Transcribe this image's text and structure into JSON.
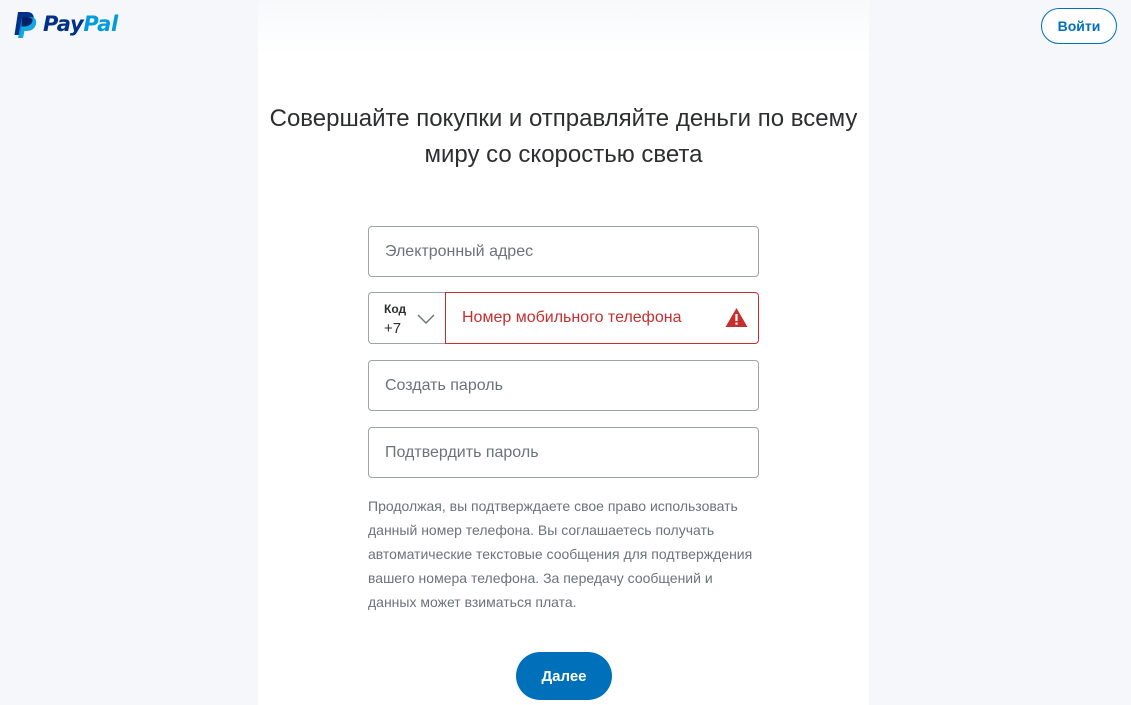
{
  "header": {
    "logo": {
      "text_part1": "Pay",
      "text_part2": "Pal",
      "icon": "paypal-p-icon"
    },
    "login_label": "Войти"
  },
  "form": {
    "headline": "Совершайте покупки и отправляйте деньги по всему миру со скоростью света",
    "email_placeholder": "Электронный адрес",
    "country_code": {
      "label": "Код",
      "value": "+7",
      "icon": "chevron-down-icon"
    },
    "phone": {
      "placeholder": "Номер мобильного телефона",
      "error_icon": "warning-triangle-icon",
      "status": "error"
    },
    "password_placeholder": "Создать пароль",
    "confirm_password_placeholder": "Подтвердить пароль",
    "disclaimer": "Продолжая, вы подтверждаете свое право использовать данный номер телефона. Вы соглашаетесь получать автоматические текстовые сообщения для подтверждения вашего номера телефона. За передачу сообщений и данных может взиматься плата.",
    "next_label": "Далее"
  },
  "colors": {
    "brand_dark": "#003087",
    "brand_light": "#009cde",
    "primary": "#0070ba",
    "error": "#c72e2e",
    "text": "#2c2e2f",
    "muted_text": "#6c7378",
    "page_background": "#f5f7fa"
  }
}
